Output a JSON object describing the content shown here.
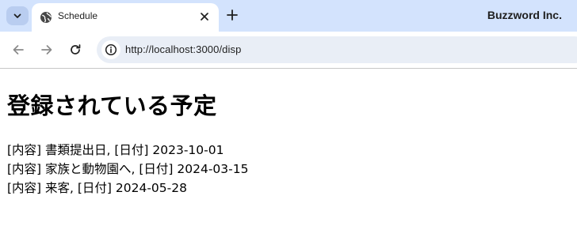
{
  "browser": {
    "tab": {
      "title": "Schedule",
      "favicon": "globe-icon"
    },
    "profile_name": "Buzzword Inc.",
    "address_bar": {
      "url": "http://localhost:3000/disp"
    },
    "colors": {
      "tabstrip": "#d3e3fd",
      "omnibox": "#e9eef6"
    }
  },
  "page": {
    "heading": "登録されている予定",
    "items": [
      "[内容] 書類提出日, [日付] 2023-10-01",
      "[内容] 家族と動物園へ, [日付] 2024-03-15",
      "[内容] 来客, [日付] 2024-05-28"
    ]
  }
}
